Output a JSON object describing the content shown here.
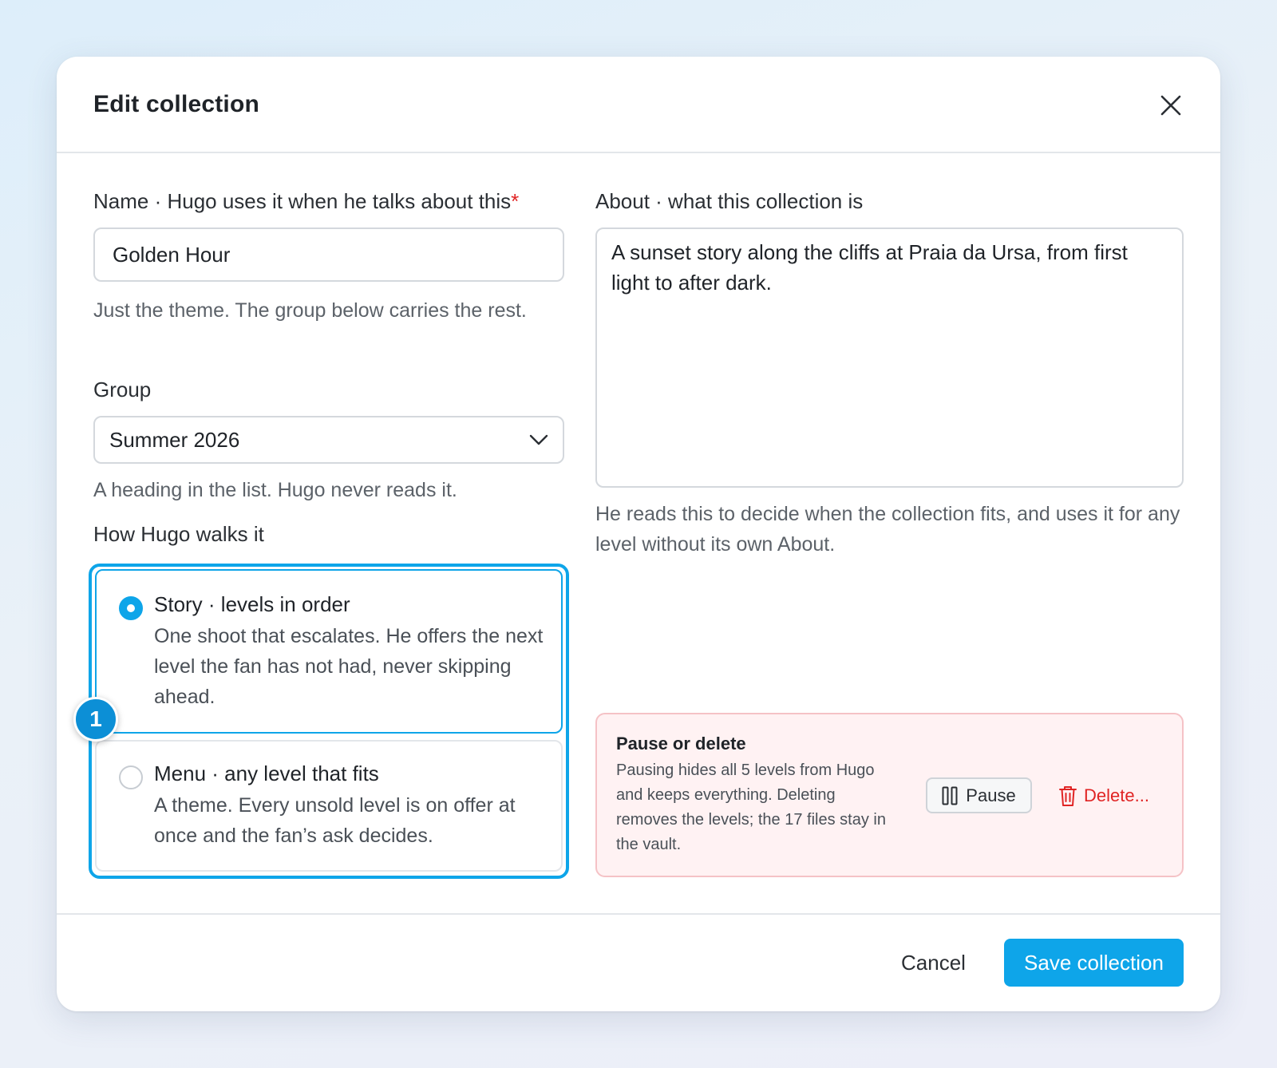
{
  "modal": {
    "title": "Edit collection"
  },
  "name_field": {
    "label": "Name · Hugo uses it when he talks about this",
    "required_mark": "*",
    "value": "Golden Hour",
    "help": "Just the theme. The group below carries the rest."
  },
  "group_field": {
    "label": "Group",
    "selected": "Summer 2026",
    "help": "A heading in the list. Hugo never reads it."
  },
  "walk_field": {
    "label": "How Hugo walks it",
    "step_badge": "1",
    "options": [
      {
        "title": "Story · levels in order",
        "description": "One shoot that escalates. He offers the next level the fan has not had, never skipping ahead.",
        "selected": true
      },
      {
        "title": "Menu · any level that fits",
        "description": "A theme. Every unsold level is on offer at once and the fan’s ask decides.",
        "selected": false
      }
    ]
  },
  "about_field": {
    "label": "About · what this collection is",
    "value": "A sunset story along the cliffs at Praia da Ursa, from first light to after dark.",
    "help": "He reads this to decide when the collection fits, and uses it for any level without its own About."
  },
  "danger_zone": {
    "title": "Pause or delete",
    "text": "Pausing hides all 5 levels from Hugo and keeps everything. Deleting removes the levels; the 17 files stay in the vault.",
    "pause_label": "Pause",
    "delete_label": "Delete..."
  },
  "footer": {
    "cancel_label": "Cancel",
    "save_label": "Save collection"
  },
  "colors": {
    "accent": "#0ea5e9",
    "danger": "#e02424",
    "danger_bg": "#fff2f3"
  },
  "icons": [
    "close-icon",
    "chevron-down-icon",
    "pause-icon",
    "trash-icon"
  ]
}
